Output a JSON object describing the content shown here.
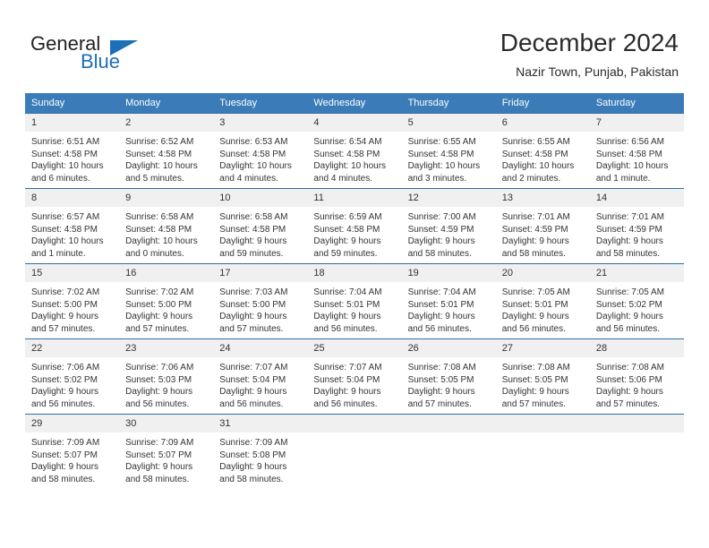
{
  "brand": {
    "name_part1": "General",
    "name_part2": "Blue",
    "triangle_icon": "triangle-icon",
    "colors": {
      "dark": "#231f20",
      "blue": "#1d6fb8"
    }
  },
  "header": {
    "title": "December 2024",
    "subtitle": "Nazir Town, Punjab, Pakistan"
  },
  "theme": {
    "header_row_bg": "#3b7cb8",
    "row_border": "#2f6ea5",
    "daynum_bg": "#f0f0f0",
    "text": "#333333"
  },
  "weekdays": [
    "Sunday",
    "Monday",
    "Tuesday",
    "Wednesday",
    "Thursday",
    "Friday",
    "Saturday"
  ],
  "labels": {
    "sunrise": "Sunrise:",
    "sunset": "Sunset:",
    "daylight": "Daylight:"
  },
  "weeks": [
    [
      {
        "day": "1",
        "sunrise": "Sunrise: 6:51 AM",
        "sunset": "Sunset: 4:58 PM",
        "daylight_1": "Daylight: 10 hours",
        "daylight_2": "and 6 minutes."
      },
      {
        "day": "2",
        "sunrise": "Sunrise: 6:52 AM",
        "sunset": "Sunset: 4:58 PM",
        "daylight_1": "Daylight: 10 hours",
        "daylight_2": "and 5 minutes."
      },
      {
        "day": "3",
        "sunrise": "Sunrise: 6:53 AM",
        "sunset": "Sunset: 4:58 PM",
        "daylight_1": "Daylight: 10 hours",
        "daylight_2": "and 4 minutes."
      },
      {
        "day": "4",
        "sunrise": "Sunrise: 6:54 AM",
        "sunset": "Sunset: 4:58 PM",
        "daylight_1": "Daylight: 10 hours",
        "daylight_2": "and 4 minutes."
      },
      {
        "day": "5",
        "sunrise": "Sunrise: 6:55 AM",
        "sunset": "Sunset: 4:58 PM",
        "daylight_1": "Daylight: 10 hours",
        "daylight_2": "and 3 minutes."
      },
      {
        "day": "6",
        "sunrise": "Sunrise: 6:55 AM",
        "sunset": "Sunset: 4:58 PM",
        "daylight_1": "Daylight: 10 hours",
        "daylight_2": "and 2 minutes."
      },
      {
        "day": "7",
        "sunrise": "Sunrise: 6:56 AM",
        "sunset": "Sunset: 4:58 PM",
        "daylight_1": "Daylight: 10 hours",
        "daylight_2": "and 1 minute."
      }
    ],
    [
      {
        "day": "8",
        "sunrise": "Sunrise: 6:57 AM",
        "sunset": "Sunset: 4:58 PM",
        "daylight_1": "Daylight: 10 hours",
        "daylight_2": "and 1 minute."
      },
      {
        "day": "9",
        "sunrise": "Sunrise: 6:58 AM",
        "sunset": "Sunset: 4:58 PM",
        "daylight_1": "Daylight: 10 hours",
        "daylight_2": "and 0 minutes."
      },
      {
        "day": "10",
        "sunrise": "Sunrise: 6:58 AM",
        "sunset": "Sunset: 4:58 PM",
        "daylight_1": "Daylight: 9 hours",
        "daylight_2": "and 59 minutes."
      },
      {
        "day": "11",
        "sunrise": "Sunrise: 6:59 AM",
        "sunset": "Sunset: 4:58 PM",
        "daylight_1": "Daylight: 9 hours",
        "daylight_2": "and 59 minutes."
      },
      {
        "day": "12",
        "sunrise": "Sunrise: 7:00 AM",
        "sunset": "Sunset: 4:59 PM",
        "daylight_1": "Daylight: 9 hours",
        "daylight_2": "and 58 minutes."
      },
      {
        "day": "13",
        "sunrise": "Sunrise: 7:01 AM",
        "sunset": "Sunset: 4:59 PM",
        "daylight_1": "Daylight: 9 hours",
        "daylight_2": "and 58 minutes."
      },
      {
        "day": "14",
        "sunrise": "Sunrise: 7:01 AM",
        "sunset": "Sunset: 4:59 PM",
        "daylight_1": "Daylight: 9 hours",
        "daylight_2": "and 58 minutes."
      }
    ],
    [
      {
        "day": "15",
        "sunrise": "Sunrise: 7:02 AM",
        "sunset": "Sunset: 5:00 PM",
        "daylight_1": "Daylight: 9 hours",
        "daylight_2": "and 57 minutes."
      },
      {
        "day": "16",
        "sunrise": "Sunrise: 7:02 AM",
        "sunset": "Sunset: 5:00 PM",
        "daylight_1": "Daylight: 9 hours",
        "daylight_2": "and 57 minutes."
      },
      {
        "day": "17",
        "sunrise": "Sunrise: 7:03 AM",
        "sunset": "Sunset: 5:00 PM",
        "daylight_1": "Daylight: 9 hours",
        "daylight_2": "and 57 minutes."
      },
      {
        "day": "18",
        "sunrise": "Sunrise: 7:04 AM",
        "sunset": "Sunset: 5:01 PM",
        "daylight_1": "Daylight: 9 hours",
        "daylight_2": "and 56 minutes."
      },
      {
        "day": "19",
        "sunrise": "Sunrise: 7:04 AM",
        "sunset": "Sunset: 5:01 PM",
        "daylight_1": "Daylight: 9 hours",
        "daylight_2": "and 56 minutes."
      },
      {
        "day": "20",
        "sunrise": "Sunrise: 7:05 AM",
        "sunset": "Sunset: 5:01 PM",
        "daylight_1": "Daylight: 9 hours",
        "daylight_2": "and 56 minutes."
      },
      {
        "day": "21",
        "sunrise": "Sunrise: 7:05 AM",
        "sunset": "Sunset: 5:02 PM",
        "daylight_1": "Daylight: 9 hours",
        "daylight_2": "and 56 minutes."
      }
    ],
    [
      {
        "day": "22",
        "sunrise": "Sunrise: 7:06 AM",
        "sunset": "Sunset: 5:02 PM",
        "daylight_1": "Daylight: 9 hours",
        "daylight_2": "and 56 minutes."
      },
      {
        "day": "23",
        "sunrise": "Sunrise: 7:06 AM",
        "sunset": "Sunset: 5:03 PM",
        "daylight_1": "Daylight: 9 hours",
        "daylight_2": "and 56 minutes."
      },
      {
        "day": "24",
        "sunrise": "Sunrise: 7:07 AM",
        "sunset": "Sunset: 5:04 PM",
        "daylight_1": "Daylight: 9 hours",
        "daylight_2": "and 56 minutes."
      },
      {
        "day": "25",
        "sunrise": "Sunrise: 7:07 AM",
        "sunset": "Sunset: 5:04 PM",
        "daylight_1": "Daylight: 9 hours",
        "daylight_2": "and 56 minutes."
      },
      {
        "day": "26",
        "sunrise": "Sunrise: 7:08 AM",
        "sunset": "Sunset: 5:05 PM",
        "daylight_1": "Daylight: 9 hours",
        "daylight_2": "and 57 minutes."
      },
      {
        "day": "27",
        "sunrise": "Sunrise: 7:08 AM",
        "sunset": "Sunset: 5:05 PM",
        "daylight_1": "Daylight: 9 hours",
        "daylight_2": "and 57 minutes."
      },
      {
        "day": "28",
        "sunrise": "Sunrise: 7:08 AM",
        "sunset": "Sunset: 5:06 PM",
        "daylight_1": "Daylight: 9 hours",
        "daylight_2": "and 57 minutes."
      }
    ],
    [
      {
        "day": "29",
        "sunrise": "Sunrise: 7:09 AM",
        "sunset": "Sunset: 5:07 PM",
        "daylight_1": "Daylight: 9 hours",
        "daylight_2": "and 58 minutes."
      },
      {
        "day": "30",
        "sunrise": "Sunrise: 7:09 AM",
        "sunset": "Sunset: 5:07 PM",
        "daylight_1": "Daylight: 9 hours",
        "daylight_2": "and 58 minutes."
      },
      {
        "day": "31",
        "sunrise": "Sunrise: 7:09 AM",
        "sunset": "Sunset: 5:08 PM",
        "daylight_1": "Daylight: 9 hours",
        "daylight_2": "and 58 minutes."
      },
      {
        "day": "",
        "sunrise": "",
        "sunset": "",
        "daylight_1": "",
        "daylight_2": ""
      },
      {
        "day": "",
        "sunrise": "",
        "sunset": "",
        "daylight_1": "",
        "daylight_2": ""
      },
      {
        "day": "",
        "sunrise": "",
        "sunset": "",
        "daylight_1": "",
        "daylight_2": ""
      },
      {
        "day": "",
        "sunrise": "",
        "sunset": "",
        "daylight_1": "",
        "daylight_2": ""
      }
    ]
  ]
}
